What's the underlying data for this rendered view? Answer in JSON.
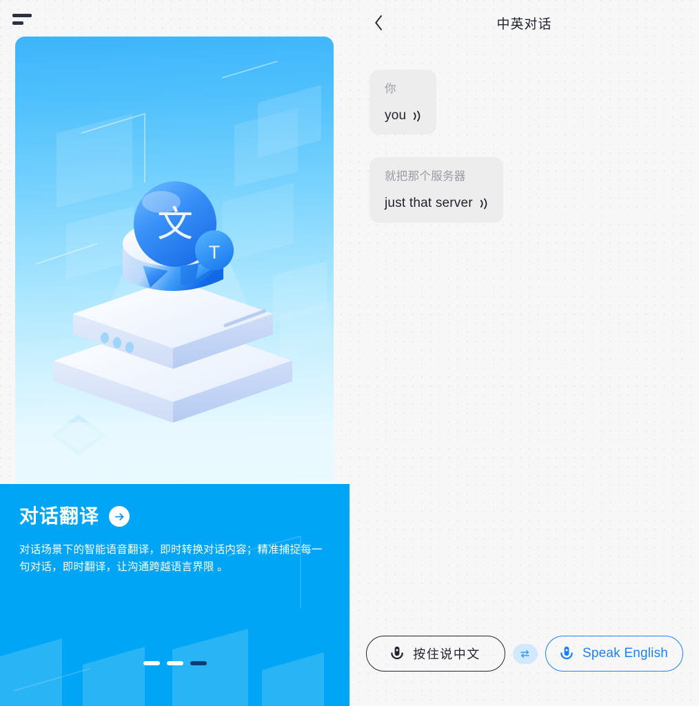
{
  "left": {
    "menu_icon": "hamburger-menu-icon",
    "illustration": {
      "bubble_large_char": "文",
      "bubble_small_char": "T",
      "alt": "isometric-translation-device-illustration"
    },
    "promo": {
      "title": "对话翻译",
      "arrow_icon": "arrow-right-icon",
      "description": "对话场景下的智能语音翻译，即时转换对话内容；精准捕捉每一句对话，即时翻译，让沟通跨越语言界限 。",
      "dots": [
        {
          "active": false
        },
        {
          "active": false
        },
        {
          "active": true
        }
      ],
      "bg_color": "#00a6f5"
    }
  },
  "right": {
    "topbar": {
      "back_icon": "chevron-left-icon",
      "title": "中英对话"
    },
    "messages": [
      {
        "source": "你",
        "target": "you",
        "speaker_icon": "sound-wave-icon"
      },
      {
        "source": "就把那个服务器",
        "target": "just that server",
        "speaker_icon": "sound-wave-icon"
      }
    ],
    "bottom": {
      "mic_zh": {
        "label": "按住说中文",
        "icon": "microphone-icon",
        "color": "#20232b"
      },
      "swap": {
        "icon": "swap-horizontal-icon",
        "bg_color": "#d2e8fd",
        "color": "#3b9bfc"
      },
      "mic_en": {
        "label": "Speak English",
        "icon": "microphone-icon",
        "color": "#1a80ff"
      }
    }
  }
}
